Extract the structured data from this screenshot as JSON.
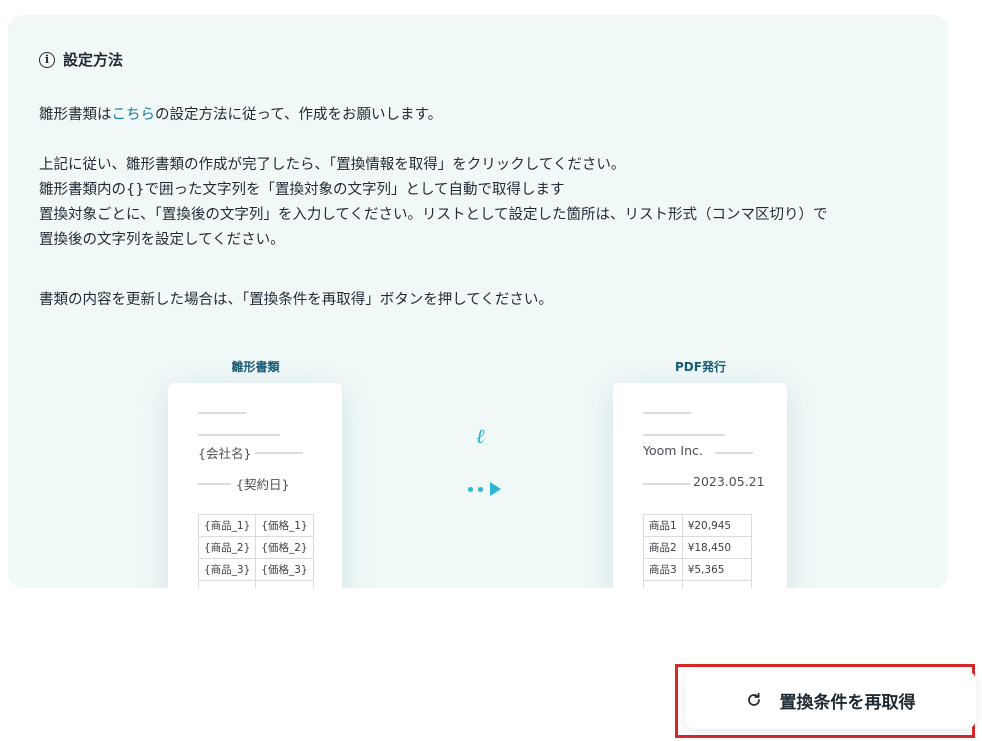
{
  "panel": {
    "title": "設定方法",
    "info_icon": "info-circle-icon",
    "paragraph1_before": "雛形書類は",
    "paragraph1_link": "こちら",
    "paragraph1_after": "の設定方法に従って、作成をお願いします。",
    "paragraph2_line1": "上記に従い、雛形書類の作成が完了したら、「置換情報を取得」をクリックしてください。",
    "paragraph2_line2": "雛形書類内の{}で囲った文字列を「置換対象の文字列」として自動で取得します",
    "paragraph2_line3": "置換対象ごとに、「置換後の文字列」を入力してください。リストとして設定した箇所は、リスト形式（コンマ区切り）で",
    "paragraph2_line4": "置換後の文字列を設定してください。",
    "paragraph3": "書類の内容を更新した場合は、「置換条件を再取得」ボタンを押してください。"
  },
  "illustration": {
    "template_label": "雛形書類",
    "output_label": "PDF発行",
    "template_doc": {
      "company": "{会社名}",
      "date": "{契約日}",
      "rows": [
        [
          "{商品_1}",
          "{価格_1}"
        ],
        [
          "{商品_2}",
          "{価格_2}"
        ],
        [
          "{商品_3}",
          "{価格_3}"
        ]
      ]
    },
    "output_doc": {
      "company": "Yoom Inc.",
      "date": "2023.05.21",
      "rows": [
        [
          "商品1",
          "¥20,945"
        ],
        [
          "商品2",
          "¥18,450"
        ],
        [
          "商品3",
          "¥5,365"
        ]
      ]
    },
    "accent_color": "#2bb5d3"
  },
  "footer": {
    "refetch_label": "置換条件を再取得",
    "refetch_icon": "refresh-icon",
    "highlight_color": "#d62828"
  }
}
